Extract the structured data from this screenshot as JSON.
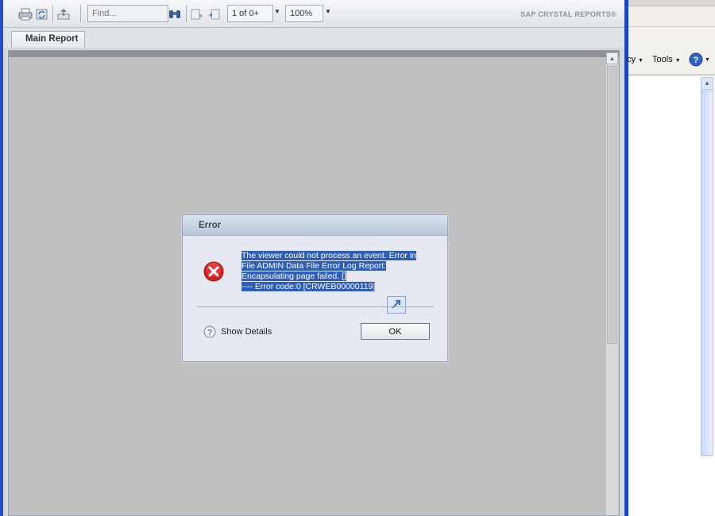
{
  "viewer": {
    "toolbar": {
      "find_placeholder": "Find...",
      "page_indicator": "1 of 0+",
      "zoom_level": "100%",
      "brand": "SAP CRYSTAL REPORTS®"
    },
    "tabs": [
      {
        "label": "Main Report"
      }
    ]
  },
  "dialog": {
    "title": "Error",
    "message_lines": [
      "The viewer could not process an event. Error in",
      "File ADMIN Data File Error Log Report:",
      "Encapsulating page failed. []",
      "---- Error code:0 [CRWEB00000119]"
    ],
    "show_details_label": "Show Details",
    "ok_label": "OK"
  },
  "browser": {
    "safety_menu_label": "cy",
    "tools_menu_label": "Tools"
  },
  "colors": {
    "accent_blue": "#1f50c9",
    "error_red": "#d92020",
    "selection": "#2f5fb5"
  }
}
